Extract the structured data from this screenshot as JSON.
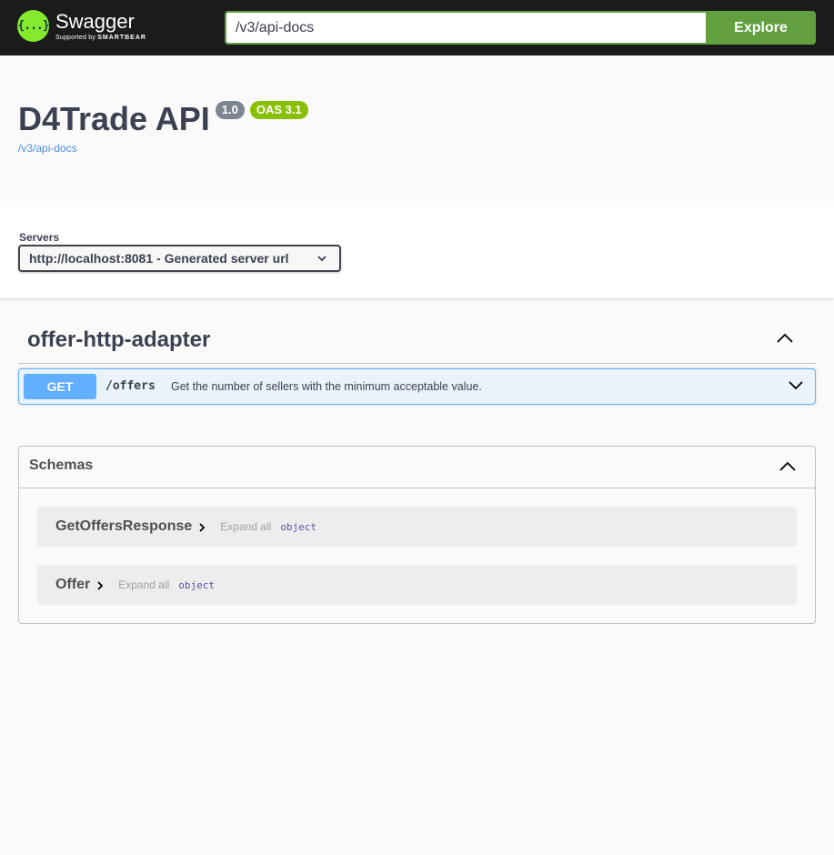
{
  "topbar": {
    "logo_name": "Swagger",
    "logo_sub_prefix": "Supported by",
    "logo_sub_brand": "SMARTBEAR",
    "logo_glyph": "{...}",
    "url_value": "/v3/api-docs",
    "explore_label": "Explore"
  },
  "info": {
    "title": "D4Trade API",
    "version": "1.0",
    "oas": "OAS 3.1",
    "spec_link": "/v3/api-docs"
  },
  "servers": {
    "label": "Servers",
    "selected": "http://localhost:8081 - Generated server url"
  },
  "tag": {
    "name": "offer-http-adapter",
    "operations": [
      {
        "method": "GET",
        "path": "/offers",
        "summary": "Get the number of sellers with the minimum acceptable value."
      }
    ]
  },
  "schemas": {
    "title": "Schemas",
    "models": [
      {
        "name": "GetOffersResponse",
        "expand_label": "Expand all",
        "type": "object"
      },
      {
        "name": "Offer",
        "expand_label": "Expand all",
        "type": "object"
      }
    ]
  },
  "colors": {
    "topbar_bg": "#1b1b1b",
    "explore_green": "#62a03f",
    "get_blue": "#61affe",
    "oas_badge": "#89bf04",
    "version_badge": "#7d8492",
    "logo_green": "#85ea2d"
  }
}
